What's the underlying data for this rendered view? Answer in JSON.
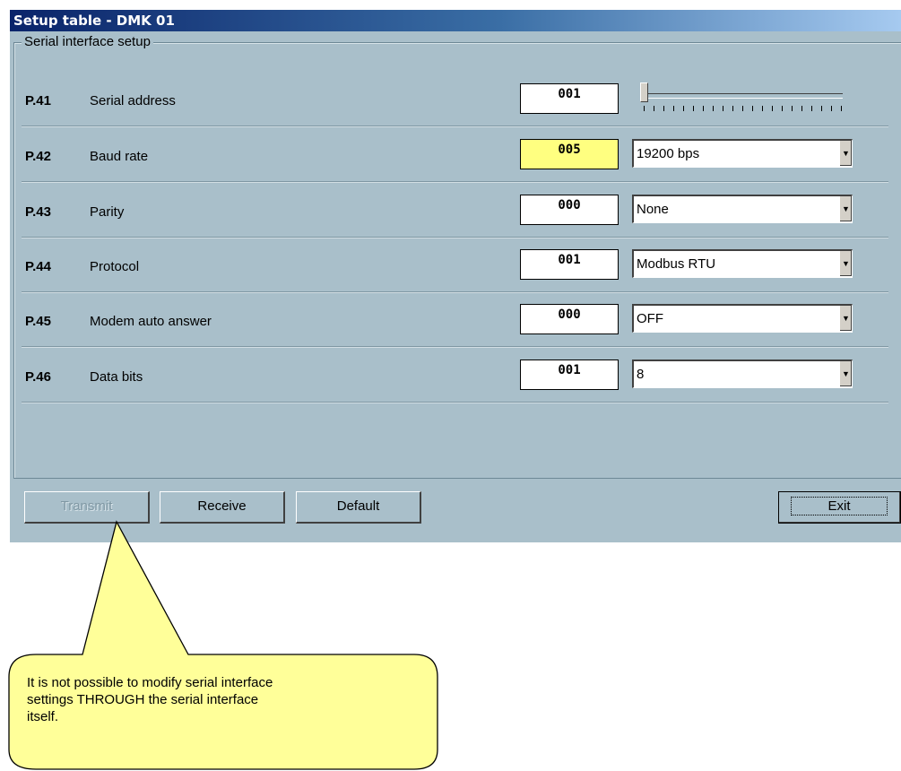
{
  "window": {
    "title": "Setup table - DMK 01"
  },
  "group": {
    "label": "Serial interface setup"
  },
  "rows": [
    {
      "pnum": "P.41",
      "label": "Serial address",
      "value": "001",
      "control": "slider",
      "slider_fraction": 0.0
    },
    {
      "pnum": "P.42",
      "label": "Baud rate",
      "value": "005",
      "control": "combo",
      "selected": "19200 bps",
      "highlight": true
    },
    {
      "pnum": "P.43",
      "label": "Parity",
      "value": "000",
      "control": "combo",
      "selected": "None"
    },
    {
      "pnum": "P.44",
      "label": "Protocol",
      "value": "001",
      "control": "combo",
      "selected": "Modbus RTU"
    },
    {
      "pnum": "P.45",
      "label": "Modem auto answer",
      "value": "000",
      "control": "combo",
      "selected": "OFF"
    },
    {
      "pnum": "P.46",
      "label": "Data bits",
      "value": "001",
      "control": "combo",
      "selected": "8"
    }
  ],
  "buttons": {
    "transmit": "Transmit",
    "receive": "Receive",
    "default": "Default",
    "exit": "Exit"
  },
  "callout": {
    "line1": "It is not possible to modify serial interface",
    "line2": "settings THROUGH the serial interface",
    "line3": "itself."
  },
  "colors": {
    "window_bg": "#a9bfca",
    "highlight": "#ffff80",
    "callout_fill": "#ffff99"
  },
  "icons": {
    "combo_arrow": "chevron-down-icon"
  }
}
